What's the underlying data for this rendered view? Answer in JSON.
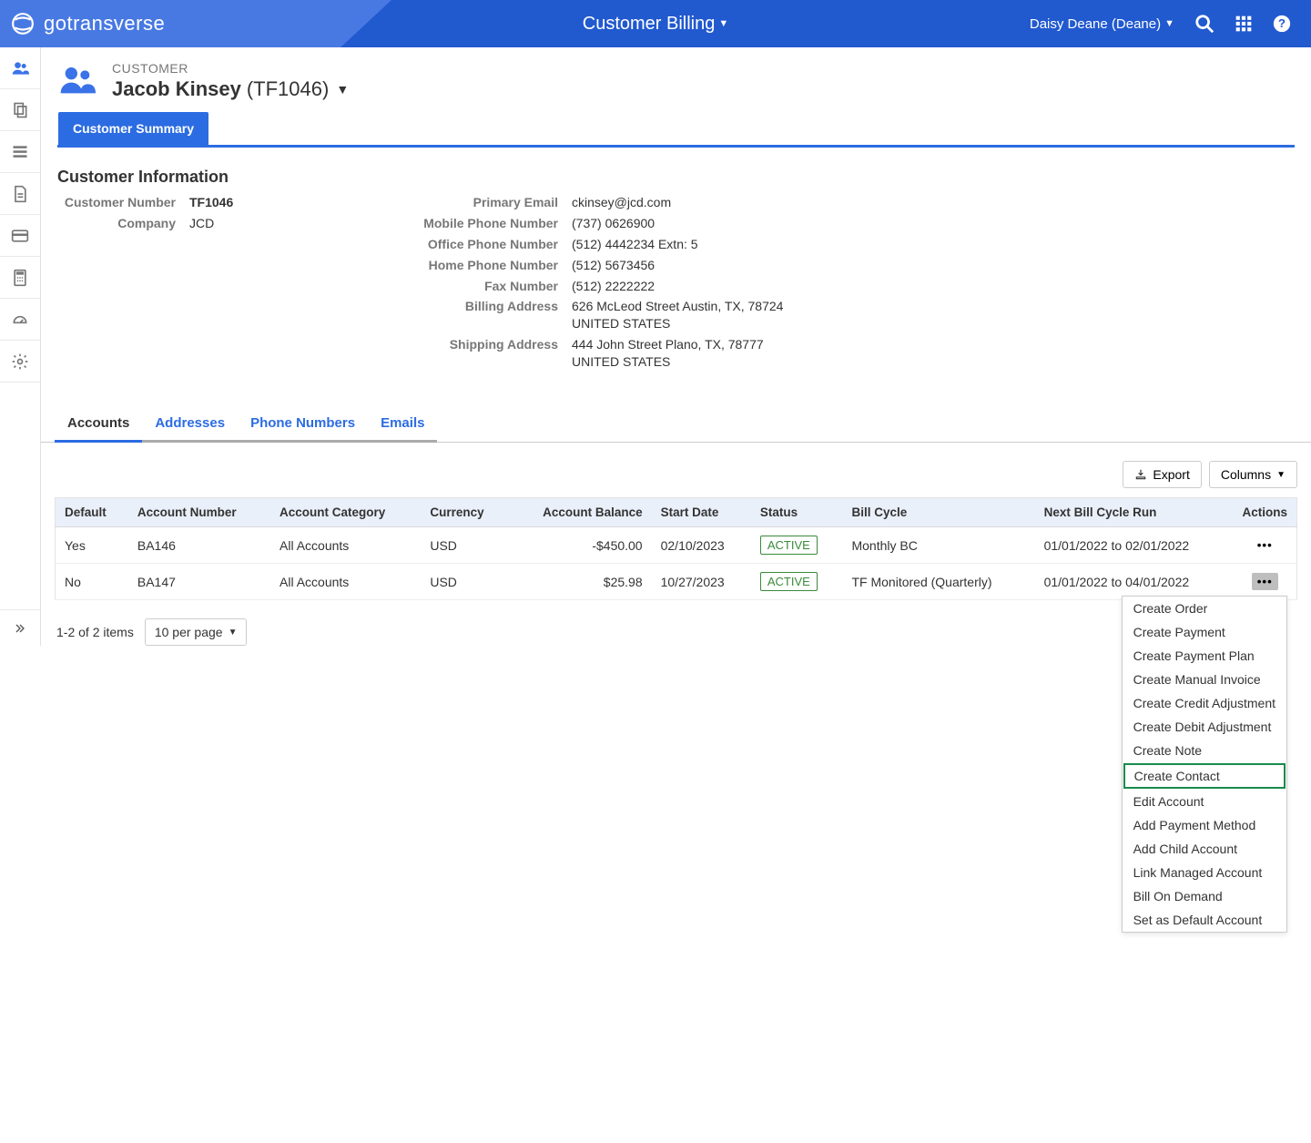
{
  "header": {
    "logo_text": "gotransverse",
    "title": "Customer Billing",
    "user": "Daisy Deane (Deane)"
  },
  "sidebar": {
    "items": [
      {
        "name": "customers-icon"
      },
      {
        "name": "copy-icon"
      },
      {
        "name": "stack-icon"
      },
      {
        "name": "document-icon"
      },
      {
        "name": "card-icon"
      },
      {
        "name": "calculator-icon"
      },
      {
        "name": "dashboard-icon"
      },
      {
        "name": "gear-icon"
      }
    ]
  },
  "page": {
    "eyebrow": "CUSTOMER",
    "name": "Jacob Kinsey",
    "code": "(TF1046)",
    "tab": "Customer Summary"
  },
  "info": {
    "title": "Customer Information",
    "left": [
      {
        "label": "Customer Number",
        "value": "TF1046",
        "strong": true
      },
      {
        "label": "Company",
        "value": "JCD"
      }
    ],
    "right": [
      {
        "label": "Primary Email",
        "value": "ckinsey@jcd.com"
      },
      {
        "label": "Mobile Phone Number",
        "value": "(737) 0626900"
      },
      {
        "label": "Office Phone Number",
        "value": "(512) 4442234 Extn: 5"
      },
      {
        "label": "Home Phone Number",
        "value": "(512) 5673456"
      },
      {
        "label": "Fax Number",
        "value": "(512) 2222222"
      },
      {
        "label": "Billing Address",
        "value": "626 McLeod Street Austin, TX, 78724 UNITED STATES"
      },
      {
        "label": "Shipping Address",
        "value": "444 John Street Plano, TX, 78777 UNITED STATES"
      }
    ]
  },
  "subtabs": [
    "Accounts",
    "Addresses",
    "Phone Numbers",
    "Emails"
  ],
  "tableControls": {
    "export": "Export",
    "columns": "Columns"
  },
  "table": {
    "columns": [
      "Default",
      "Account Number",
      "Account Category",
      "Currency",
      "Account Balance",
      "Start Date",
      "Status",
      "Bill Cycle",
      "Next Bill Cycle Run",
      "Actions"
    ],
    "rows": [
      {
        "default": "Yes",
        "acct": "BA146",
        "cat": "All Accounts",
        "cur": "USD",
        "bal": "-$450.00",
        "start": "02/10/2023",
        "status": "ACTIVE",
        "bill": "Monthly BC",
        "next": "01/01/2022 to 02/01/2022"
      },
      {
        "default": "No",
        "acct": "BA147",
        "cat": "All Accounts",
        "cur": "USD",
        "bal": "$25.98",
        "start": "10/27/2023",
        "status": "ACTIVE",
        "bill": "TF Monitored (Quarterly)",
        "next": "01/01/2022 to 04/01/2022"
      }
    ]
  },
  "actionMenu": [
    "Create Order",
    "Create Payment",
    "Create Payment Plan",
    "Create Manual Invoice",
    "Create Credit Adjustment",
    "Create Debit Adjustment",
    "Create Note",
    "Create Contact",
    "Edit Account",
    "Add Payment Method",
    "Add Child Account",
    "Link Managed Account",
    "Bill On Demand",
    "Set as Default Account"
  ],
  "actionMenuHighlightIndex": 7,
  "pager": {
    "summary": "1-2 of 2 items",
    "size": "10 per page"
  }
}
